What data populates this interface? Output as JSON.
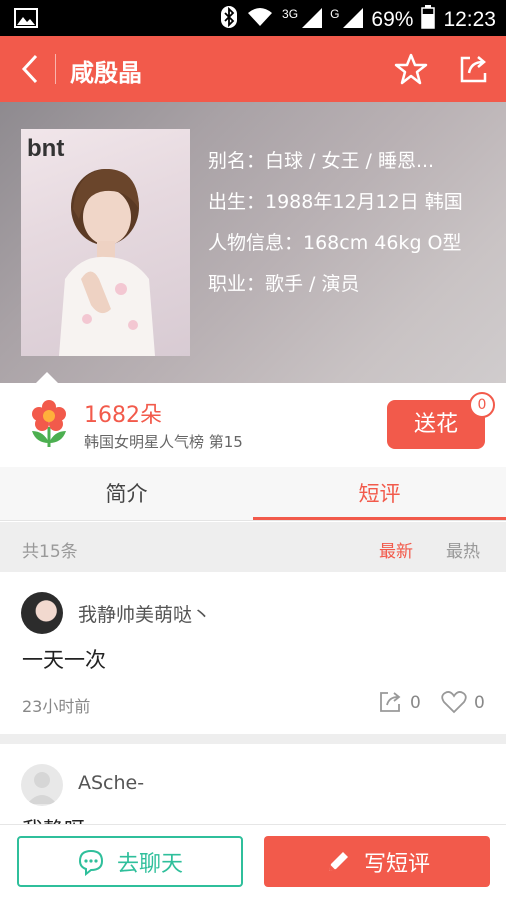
{
  "status_bar": {
    "network_label": "3G",
    "signal2_label": "G",
    "battery": "69%",
    "time": "12:23"
  },
  "app_bar": {
    "title": "咸殷晶"
  },
  "profile": {
    "photo_logo": "bnt",
    "alias": "别名：白球 / 女王 / 睡恩...",
    "birth": "出生：1988年12月12日 韩国",
    "info": "人物信息：168cm 46kg O型",
    "job": "职业：歌手 / 演员"
  },
  "flowers": {
    "count": "1682朵",
    "rank": "韩国女明星人气榜 第15",
    "send_label": "送花",
    "badge": "0"
  },
  "tabs": [
    {
      "label": "简介"
    },
    {
      "label": "短评"
    }
  ],
  "filter": {
    "total": "共15条",
    "newest": "最新",
    "hottest": "最热"
  },
  "comments": [
    {
      "user": "我静帅美萌哒丶",
      "text": "一天一次",
      "time": "23小时前",
      "shares": "0",
      "likes": "0"
    },
    {
      "user": "ASche-",
      "text": "我静呀"
    }
  ],
  "bottom": {
    "chat_label": "去聊天",
    "write_label": "写短评"
  },
  "colors": {
    "accent": "#f25a4b",
    "chat": "#2fbf9b"
  }
}
